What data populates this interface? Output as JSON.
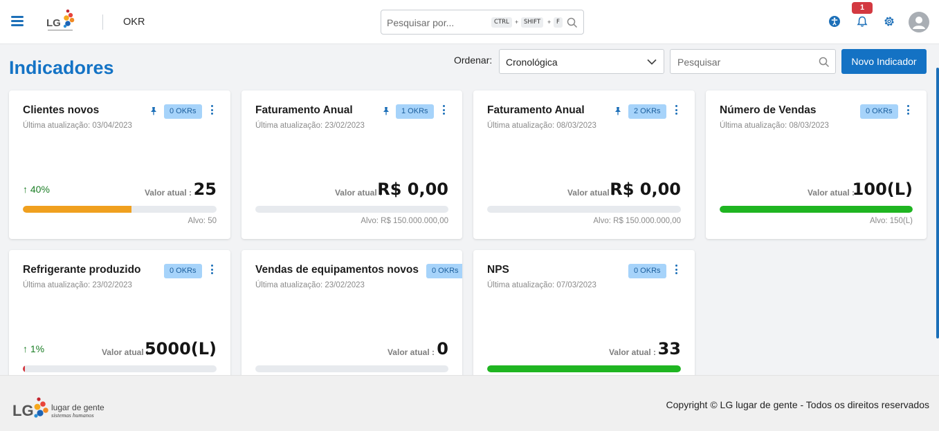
{
  "header": {
    "app_name": "OKR",
    "search_placeholder": "Pesquisar por...",
    "shortcut_keys": [
      "CTRL",
      "SHIFT",
      "F"
    ],
    "shortcut_separator": "+",
    "notification_count": "1",
    "icons": [
      "menu-icon",
      "accessibility-icon",
      "bell-icon",
      "gear-icon",
      "user-icon",
      "search-icon"
    ]
  },
  "page": {
    "title": "Indicadores",
    "sort_label": "Ordenar:",
    "sort_value": "Cronológica",
    "search_placeholder": "Pesquisar",
    "new_button": "Novo Indicador",
    "value_label": "Valor atual :"
  },
  "indicators": [
    {
      "title": "Clientes novos",
      "updated": "Última atualização: 03/04/2023",
      "okrs": "0 OKRs",
      "pinned": true,
      "trend": "40%",
      "value": "25",
      "progress": 0.56,
      "bar_color": "#f0a01f",
      "target": "Alvo: 50"
    },
    {
      "title": "Faturamento Anual",
      "updated": "Última atualização: 23/02/2023",
      "okrs": "1 OKRs",
      "pinned": true,
      "trend": "",
      "value": "R$ 0,00",
      "progress": 0,
      "bar_color": "#1fb521",
      "target": "Alvo: R$ 150.000.000,00"
    },
    {
      "title": "Faturamento Anual",
      "updated": "Última atualização: 08/03/2023",
      "okrs": "2 OKRs",
      "pinned": true,
      "trend": "",
      "value": "R$ 0,00",
      "progress": 0,
      "bar_color": "#1fb521",
      "target": "Alvo: R$ 150.000.000,00"
    },
    {
      "title": "Número de Vendas",
      "updated": "Última atualização: 08/03/2023",
      "okrs": "0 OKRs",
      "pinned": false,
      "trend": "",
      "value": "100(L)",
      "progress": 1,
      "bar_color": "#1fb521",
      "target": "Alvo: 150(L)"
    },
    {
      "title": "Refrigerante produzido",
      "updated": "Última atualização: 23/02/2023",
      "okrs": "0 OKRs",
      "pinned": false,
      "trend": "1%",
      "value": "5000(L)",
      "progress": 0.01,
      "bar_color": "#d33941",
      "target": ""
    },
    {
      "title": "Vendas de equipamentos novos",
      "updated": "Última atualização: 23/02/2023",
      "okrs": "0 OKRs",
      "pinned": false,
      "trend": "",
      "value": "0",
      "progress": 0,
      "bar_color": "#1fb521",
      "target": ""
    },
    {
      "title": "NPS",
      "updated": "Última atualização: 07/03/2023",
      "okrs": "0 OKRs",
      "pinned": false,
      "trend": "",
      "value": "33",
      "progress": 1,
      "bar_color": "#1fb521",
      "target": ""
    }
  ],
  "footer": {
    "logo_text": "lugar de gente",
    "logo_subtext": "sistemas humanos",
    "copyright": "Copyright © LG lugar de gente - Todos os direitos reservados"
  },
  "colors": {
    "brand": "#1473c5",
    "okr_badge": "#a6d3fa",
    "notification": "#d33941"
  }
}
